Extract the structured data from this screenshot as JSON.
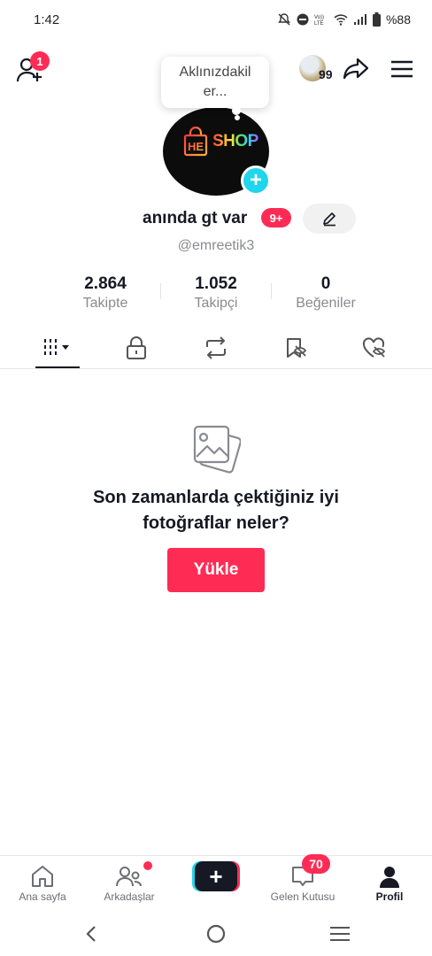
{
  "status_bar": {
    "time": "1:42",
    "battery": "%88"
  },
  "header": {
    "add_friend_badge": "1",
    "coins": "99"
  },
  "profile": {
    "tooltip": "Aklınızdakiler...",
    "tooltip_line1": "Aklınızdakil",
    "tooltip_line2": "er...",
    "avatar_text": "SHOP",
    "display_name": "anında gt var",
    "name_badge": "9+",
    "username": "@emreetik3"
  },
  "stats": [
    {
      "value": "2.864",
      "label": "Takipte"
    },
    {
      "value": "1.052",
      "label": "Takipçi"
    },
    {
      "value": "0",
      "label": "Beğeniler"
    }
  ],
  "empty_state": {
    "message_line1": "Son zamanlarda çektiğiniz iyi",
    "message_line2": "fotoğraflar neler?",
    "upload_label": "Yükle"
  },
  "bottom_nav": {
    "home": "Ana sayfa",
    "friends": "Arkadaşlar",
    "inbox": "Gelen Kutusu",
    "inbox_badge": "70",
    "profile": "Profil"
  },
  "colors": {
    "accent": "#fe2c55",
    "cyan": "#20d5ec",
    "text": "#161823",
    "muted": "#8a8b91"
  }
}
